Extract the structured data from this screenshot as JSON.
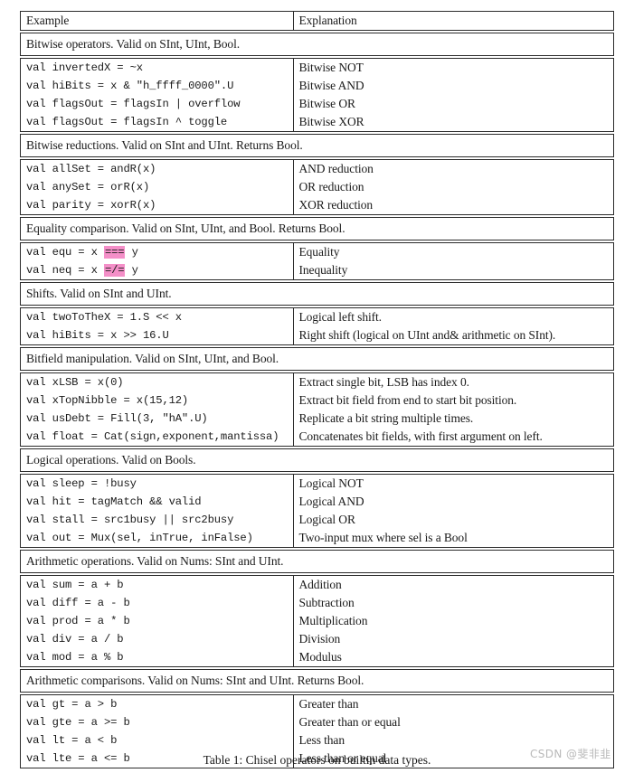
{
  "table": {
    "columns": [
      "Example",
      "Explanation"
    ],
    "blocks": [
      {
        "kind": "header_row",
        "cells": [
          "Example",
          "Explanation"
        ]
      },
      {
        "kind": "section",
        "title": "Bitwise operators. Valid on SInt, UInt, Bool."
      },
      {
        "kind": "rows",
        "rows": [
          {
            "code": "val invertedX = ~x",
            "explanation": "Bitwise NOT"
          },
          {
            "code": "val hiBits = x & \"h_ffff_0000\".U",
            "explanation": "Bitwise AND"
          },
          {
            "code": "val flagsOut = flagsIn | overflow",
            "explanation": "Bitwise OR"
          },
          {
            "code": "val flagsOut = flagsIn ^ toggle",
            "explanation": "Bitwise XOR"
          }
        ]
      },
      {
        "kind": "section",
        "title": "Bitwise reductions. Valid on SInt and UInt. Returns Bool."
      },
      {
        "kind": "rows",
        "rows": [
          {
            "code": "val allSet = andR(x)",
            "explanation": "AND reduction"
          },
          {
            "code": "val anySet = orR(x)",
            "explanation": "OR reduction"
          },
          {
            "code": "val parity = xorR(x)",
            "explanation": "XOR reduction"
          }
        ]
      },
      {
        "kind": "section",
        "title": "Equality comparison. Valid on SInt, UInt, and Bool. Returns Bool."
      },
      {
        "kind": "rows",
        "rows": [
          {
            "code_pre": "val equ = x ",
            "code_hl": "===",
            "code_post": " y",
            "explanation": "Equality"
          },
          {
            "code_pre": "val neq = x ",
            "code_hl": "=/=",
            "code_post": " y",
            "explanation": "Inequality"
          }
        ]
      },
      {
        "kind": "section",
        "title": "Shifts. Valid on SInt and UInt."
      },
      {
        "kind": "rows",
        "rows": [
          {
            "code": "val twoToTheX = 1.S << x",
            "explanation": "Logical left shift."
          },
          {
            "code": "val hiBits = x >> 16.U",
            "explanation": "Right shift (logical on UInt and& arithmetic on SInt)."
          }
        ]
      },
      {
        "kind": "section",
        "title": "Bitfield manipulation. Valid on SInt, UInt, and Bool."
      },
      {
        "kind": "rows",
        "rows": [
          {
            "code": "val xLSB = x(0)",
            "explanation": "Extract single bit, LSB has index 0."
          },
          {
            "code": "val xTopNibble = x(15,12)",
            "explanation": "Extract bit field from end to start bit position."
          },
          {
            "code": "val usDebt = Fill(3, \"hA\".U)",
            "explanation": "Replicate a bit string multiple times."
          },
          {
            "code": "val float = Cat(sign,exponent,mantissa)",
            "explanation": "Concatenates bit fields, with first argument on left."
          }
        ]
      },
      {
        "kind": "section",
        "title": "Logical operations. Valid on Bools."
      },
      {
        "kind": "rows",
        "rows": [
          {
            "code": "val sleep = !busy",
            "explanation": "Logical NOT"
          },
          {
            "code": "val hit = tagMatch && valid",
            "explanation": "Logical AND"
          },
          {
            "code": "val stall = src1busy || src2busy",
            "explanation": "Logical OR"
          },
          {
            "code": "val out = Mux(sel, inTrue, inFalse)",
            "explanation": "Two-input mux where sel is a Bool"
          }
        ]
      },
      {
        "kind": "section",
        "title": "Arithmetic operations. Valid on Nums: SInt and UInt."
      },
      {
        "kind": "rows",
        "rows": [
          {
            "code": "val sum = a + b",
            "explanation": "Addition"
          },
          {
            "code": "val diff = a - b",
            "explanation": "Subtraction"
          },
          {
            "code": "val prod = a * b",
            "explanation": "Multiplication"
          },
          {
            "code": "val div = a / b",
            "explanation": "Division"
          },
          {
            "code": "val mod = a % b",
            "explanation": "Modulus"
          }
        ]
      },
      {
        "kind": "section",
        "title": "Arithmetic comparisons. Valid on Nums: SInt and UInt. Returns Bool."
      },
      {
        "kind": "rows",
        "rows": [
          {
            "code": "val gt = a > b",
            "explanation": "Greater than"
          },
          {
            "code": "val gte = a >= b",
            "explanation": "Greater than or equal"
          },
          {
            "code": "val lt = a < b",
            "explanation": "Less than"
          },
          {
            "code": "val lte = a <= b",
            "explanation": "Less than or equal"
          }
        ]
      }
    ]
  },
  "caption": "Table 1: Chisel operators on builtin data types.",
  "watermark": "CSDN @斐非韭",
  "colors": {
    "highlight": "#f48fc8",
    "border": "#2b2b2b",
    "text": "#1a1a1a",
    "watermark": "#b9b9b9"
  }
}
